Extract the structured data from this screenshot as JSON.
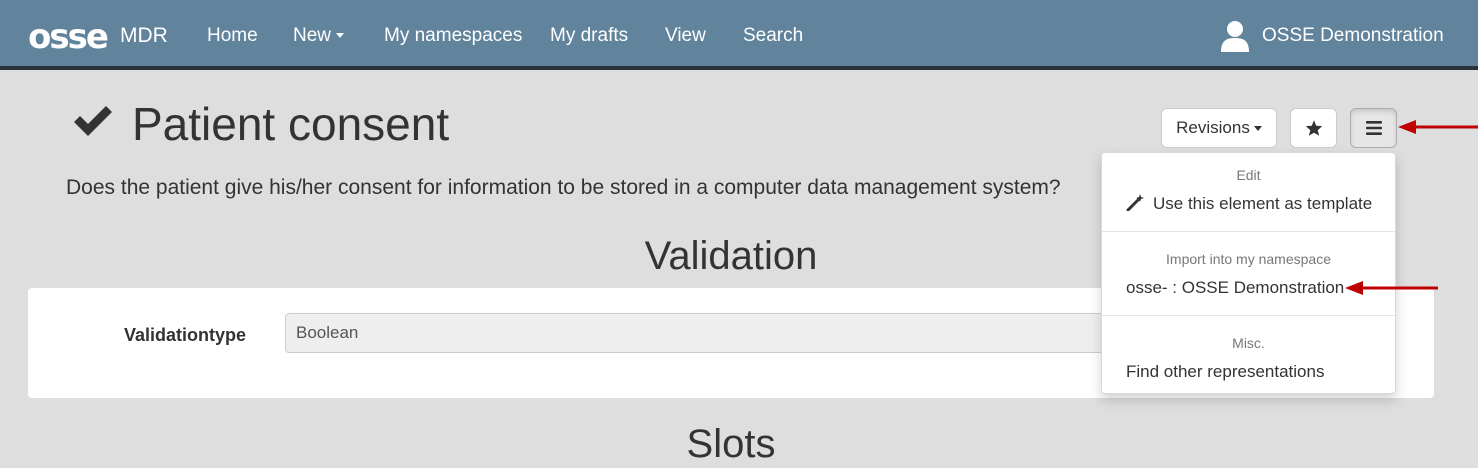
{
  "navbar": {
    "logo": "osse",
    "brand": "MDR",
    "items": [
      "Home",
      "New",
      "My namespaces",
      "My drafts",
      "View",
      "Search"
    ],
    "user": "OSSE Demonstration"
  },
  "element": {
    "title": "Patient consent",
    "description": "Does the patient give his/her consent for information to be stored in a computer data management system?",
    "status_icon": "check-icon"
  },
  "toolbar": {
    "revisions_label": "Revisions",
    "star_icon": "star-icon",
    "menu_icon": "hamburger-menu-icon"
  },
  "dropdown": {
    "sections": [
      {
        "header": "Edit",
        "items": [
          "Use this element as template"
        ]
      },
      {
        "header": "Import into my namespace",
        "items": [
          "osse- : OSSE Demonstration"
        ]
      },
      {
        "header": "Misc.",
        "items": [
          "Find other representations"
        ]
      }
    ]
  },
  "validation": {
    "title": "Validation",
    "field_label": "Validationtype",
    "field_value": "Boolean"
  },
  "slots": {
    "title": "Slots"
  },
  "colors": {
    "navbar": "#61839c",
    "background": "#dedede",
    "annotation_arrow": "#c00000"
  }
}
